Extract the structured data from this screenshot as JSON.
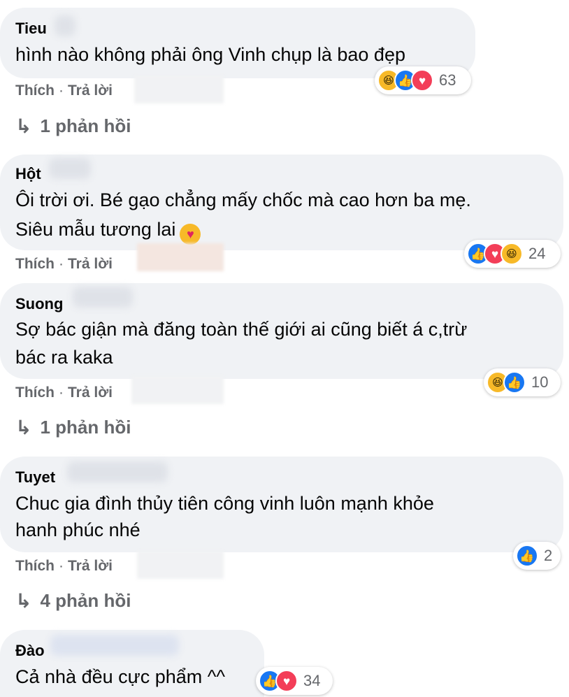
{
  "comments": [
    {
      "name": "Tieu",
      "lines": [
        "hình nào không phải ông Vinh chụp là bao đẹp"
      ],
      "reactions": {
        "icons": [
          "haha",
          "like",
          "love"
        ],
        "count": "63"
      },
      "actions": {
        "like": "Thích",
        "sep": "·",
        "reply": "Trả lời"
      },
      "replies": "1 phản hồi"
    },
    {
      "name": "Hột",
      "lines": [
        "Ôi trời ơi. Bé gạo chẳng mấy chốc mà cao hơn ba mẹ.",
        "Siêu mẫu tương lai"
      ],
      "inline_emoji": "heart-eyes",
      "reactions": {
        "icons": [
          "like",
          "love",
          "haha"
        ],
        "count": "24"
      },
      "actions": {
        "like": "Thích",
        "sep": "·",
        "reply": "Trả lời"
      }
    },
    {
      "name": "Suong",
      "lines": [
        "Sợ bác giận mà đăng toàn thế giới ai cũng biết á c,trừ",
        "bác ra kaka"
      ],
      "reactions": {
        "icons": [
          "haha",
          "like"
        ],
        "count": "10"
      },
      "actions": {
        "like": "Thích",
        "sep": "·",
        "reply": "Trả lời"
      },
      "replies": "1 phản hồi"
    },
    {
      "name": "Tuyet",
      "lines": [
        "Chuc gia đình thủy tiên công vinh luôn mạnh khỏe",
        "hanh phúc nhé"
      ],
      "reactions": {
        "icons": [
          "like"
        ],
        "count": "2"
      },
      "actions": {
        "like": "Thích",
        "sep": "·",
        "reply": "Trả lời"
      },
      "replies": "4 phản hồi"
    },
    {
      "name": "Đào",
      "lines": [
        "Cả nhà đều cực phẩm ^^"
      ],
      "reactions": {
        "icons": [
          "like",
          "love"
        ],
        "count": "34"
      }
    }
  ],
  "icons": {
    "like": "thumbs-up-icon",
    "love": "heart-icon",
    "haha": "laughing-face-icon",
    "reply_arrow": "reply-arrow-icon"
  },
  "colors": {
    "bubble": "#f0f2f5",
    "meta": "#65676b",
    "like": "#1877f2",
    "love": "#f33e58",
    "haha": "#f7b928"
  }
}
